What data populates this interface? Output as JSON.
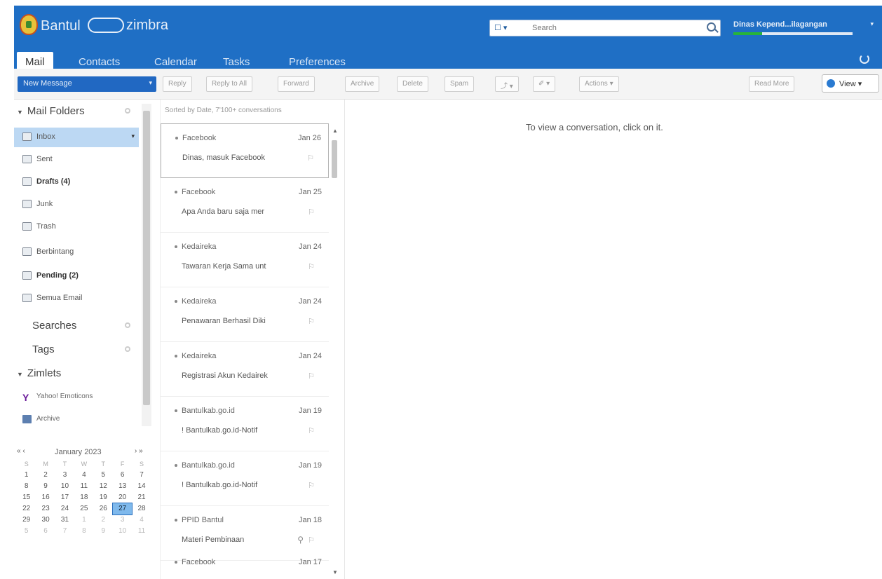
{
  "header": {
    "brand": "Bantul",
    "product": "zimbra",
    "search": {
      "scope": "☐ ▾",
      "placeholder": "Search"
    },
    "user": "Dinas Kepend...ilagangan",
    "quota_percent": 24
  },
  "tabs": [
    {
      "label": "Mail"
    },
    {
      "label": "Contacts"
    },
    {
      "label": "Calendar"
    },
    {
      "label": "Tasks"
    },
    {
      "label": "Preferences"
    }
  ],
  "toolbar": {
    "new_message": "New Message",
    "reply": "Reply",
    "reply_all": "Reply to All",
    "forward": "Forward",
    "archive": "Archive",
    "delete": "Delete",
    "spam": "Spam",
    "move": "⤴ ▾",
    "tag": "✐ ▾",
    "actions": "Actions ▾",
    "read_more": "Read More",
    "view": "View ▾"
  },
  "sidebar": {
    "mail_folders": "Mail Folders",
    "folders": [
      {
        "label": "Inbox"
      },
      {
        "label": "Sent"
      },
      {
        "label": "Drafts (4)"
      },
      {
        "label": "Junk"
      },
      {
        "label": "Trash"
      },
      {
        "label": "Berbintang"
      },
      {
        "label": "Pending (2)"
      },
      {
        "label": "Semua Email"
      }
    ],
    "searches": "Searches",
    "tags": "Tags",
    "zimlets": "Zimlets",
    "zimlet_items": [
      {
        "label": "Yahoo! Emoticons"
      },
      {
        "label": "Archive"
      }
    ]
  },
  "calendar": {
    "title": "January 2023",
    "prev": "« ‹",
    "next": "› »",
    "weekdays": [
      "S",
      "M",
      "T",
      "W",
      "T",
      "F",
      "S"
    ],
    "weeks": [
      [
        "1",
        "2",
        "3",
        "4",
        "5",
        "6",
        "7"
      ],
      [
        "8",
        "9",
        "10",
        "11",
        "12",
        "13",
        "14"
      ],
      [
        "15",
        "16",
        "17",
        "18",
        "19",
        "20",
        "21"
      ],
      [
        "22",
        "23",
        "24",
        "25",
        "26",
        "27",
        "28"
      ],
      [
        "29",
        "30",
        "31",
        "1",
        "2",
        "3",
        "4"
      ],
      [
        "5",
        "6",
        "7",
        "8",
        "9",
        "10",
        "11"
      ]
    ],
    "today": "27"
  },
  "list": {
    "header": "Sorted by Date, 7'100+ conversations",
    "messages": [
      {
        "sender": "Facebook",
        "date": "Jan 26",
        "subject": "Dinas, masuk Facebook"
      },
      {
        "sender": "Facebook",
        "date": "Jan 25",
        "subject": "Apa Anda baru saja mer"
      },
      {
        "sender": "Kedaireka",
        "date": "Jan 24",
        "subject": "Tawaran Kerja Sama unt"
      },
      {
        "sender": "Kedaireka",
        "date": "Jan 24",
        "subject": "Penawaran Berhasil Diki"
      },
      {
        "sender": "Kedaireka",
        "date": "Jan 24",
        "subject": "Registrasi Akun Kedairek"
      },
      {
        "sender": "Bantulkab.go.id",
        "date": "Jan 19",
        "subject": "! Bantulkab.go.id-Notif"
      },
      {
        "sender": "Bantulkab.go.id",
        "date": "Jan 19",
        "subject": "! Bantulkab.go.id-Notif"
      },
      {
        "sender": "PPID Bantul",
        "date": "Jan 18",
        "subject": "Materi Pembinaan"
      },
      {
        "sender": "Facebook",
        "date": "Jan 17",
        "subject": ""
      }
    ]
  },
  "reading_pane": {
    "hint": "To view a conversation, click on it."
  }
}
